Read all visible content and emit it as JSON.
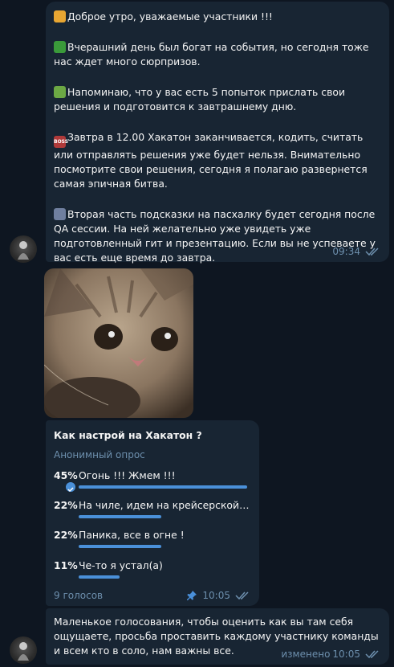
{
  "messages": [
    {
      "paragraphs": [
        {
          "emoji": "sun-icon",
          "text": "Доброе утро, уважаемые участники !!!"
        },
        {
          "emoji": "frog-icon",
          "text": "Вчерашний день был богат на события, но сегодня тоже нас ждет много сюрпризов."
        },
        {
          "emoji": "money-icon",
          "text": "Напоминаю, что у вас есть 5 попыток прислать свои решения и подготовится к завтрашнему дню."
        },
        {
          "emoji": "boss-icon",
          "text": "Завтра в 12.00 Хакатон заканчивается, кодить, считать или отправлять решения уже будет нельзя.  Внимательно посмотрите свои решения, сегодня я полагаю развернется самая эпичная битва."
        },
        {
          "emoji": "lightbulb-icon",
          "text": "Вторая часть подсказки на пасхалку будет сегодня после QA сессии. На ней желательно уже увидеть уже подготовленный гит и презентацию. Если вы не успеваете у вас есть еще время до завтра."
        }
      ],
      "boss_badge": "BOSS",
      "time": "09:34"
    }
  ],
  "poll": {
    "question": "Как настрой на Хакатон ?",
    "type_label": "Анонимный опрос",
    "options": [
      {
        "percent": "45%",
        "text": "Огонь !!! Жмем !!!",
        "fraction": 0.45,
        "chosen": true
      },
      {
        "percent": "22%",
        "text": "На чиле, идем на крейсерской скорости",
        "fraction": 0.22,
        "chosen": false
      },
      {
        "percent": "22%",
        "text": "Паника, все в огне !",
        "fraction": 0.22,
        "chosen": false
      },
      {
        "percent": "11%",
        "text": "Че-то я устал(а)",
        "fraction": 0.11,
        "chosen": false
      }
    ],
    "votes": "9 голосов",
    "time": "10:05"
  },
  "message3": {
    "text": "Маленькое голосования, чтобы оценить как вы там себя ощущаете, просьба проставить каждому участнику команды и всем кто в соло, нам важны все.",
    "edited_label": "изменено",
    "time": "10:05"
  },
  "colors": {
    "background": "#0e1621",
    "bubble": "#182533",
    "accent": "#4a90d9",
    "meta_text": "#6d8fad"
  }
}
